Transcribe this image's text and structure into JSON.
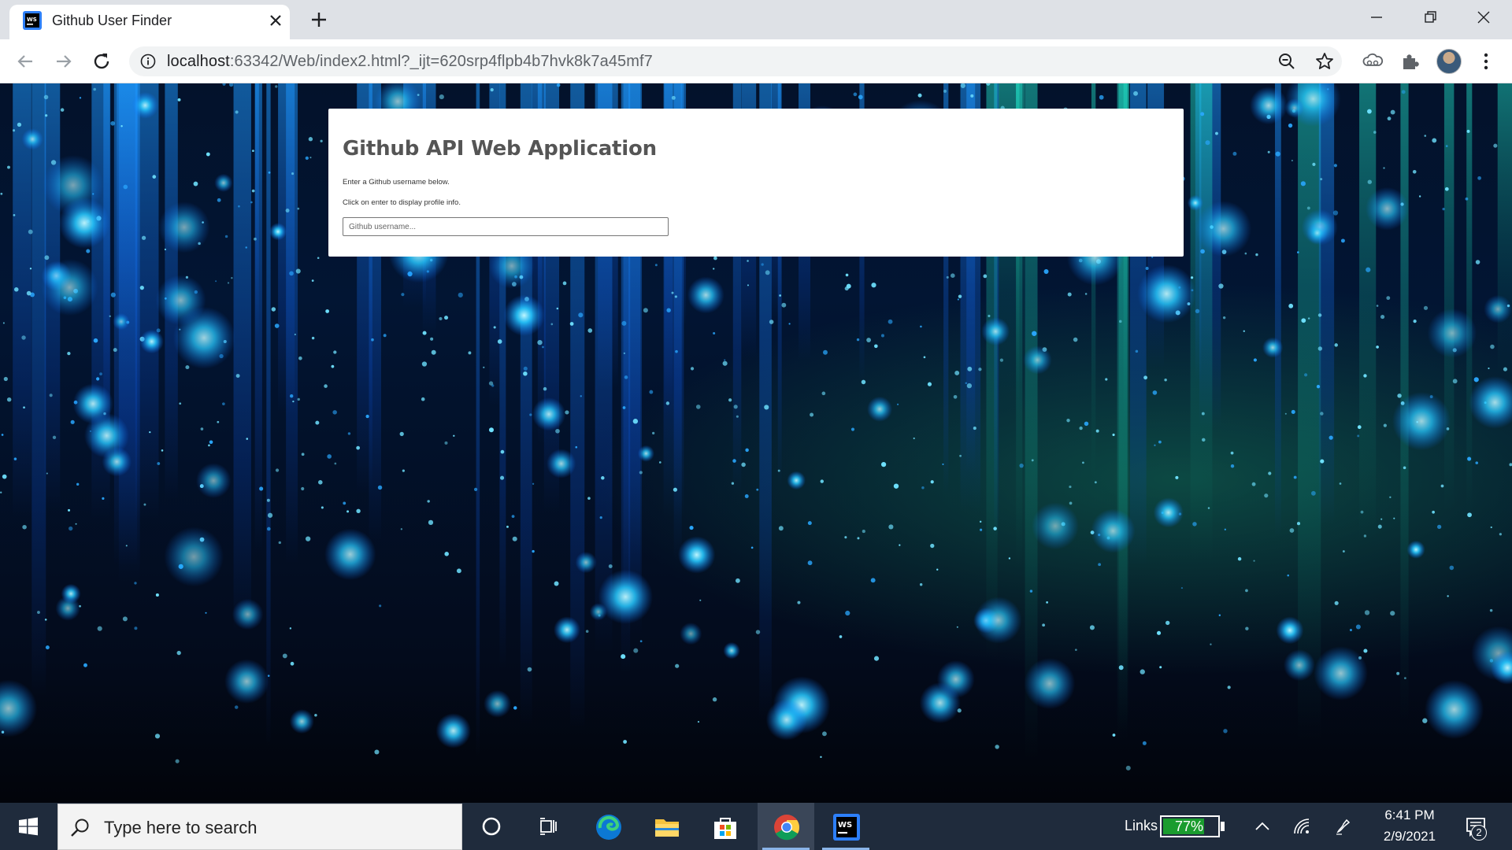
{
  "browser": {
    "tab_title": "Github User Finder",
    "url_host": "localhost",
    "url_rest": ":63342/Web/index2.html?_ijt=620srp4flpb4b7hvk8k7a45mf7"
  },
  "page": {
    "title": "Github API Web Application",
    "line1": "Enter a Github username below.",
    "line2": "Click on enter to display profile info.",
    "input_placeholder": "Github username...",
    "input_value": ""
  },
  "taskbar": {
    "search_placeholder": "Type here to search",
    "links_label": "Links",
    "battery_percent": "77%",
    "battery_level": 0.77,
    "time": "6:41 PM",
    "date": "2/9/2021",
    "notification_count": "2"
  },
  "colors": {
    "tab_strip": "#dee1e6",
    "taskbar": "#1f2b3c",
    "battery_green": "#1a9c2e",
    "card_title": "#555555"
  }
}
